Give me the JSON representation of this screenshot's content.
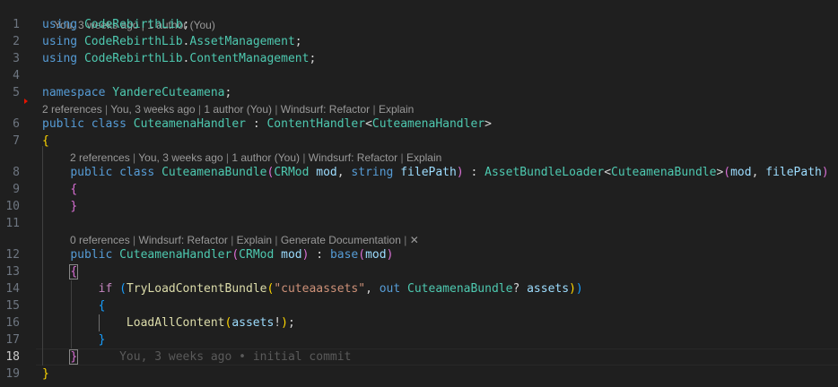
{
  "blame_header": "You, 3 weeks ago | 1 author (You)",
  "line_numbers": [
    "1",
    "2",
    "3",
    "4",
    "5",
    "6",
    "7",
    "8",
    "9",
    "10",
    "11",
    "12",
    "13",
    "14",
    "15",
    "16",
    "17",
    "18",
    "19"
  ],
  "code": {
    "using": "using",
    "ns1": "CodeRebirthLib",
    "ns2a": "CodeRebirthLib",
    "ns2b": "AssetManagement",
    "ns3a": "CodeRebirthLib",
    "ns3b": "ContentManagement",
    "namespace_kw": "namespace",
    "namespace_name": "YandereCuteamena",
    "public": "public",
    "class": "class",
    "string": "string",
    "out": "out",
    "base": "base",
    "if": "if",
    "handler_class": "CuteamenaHandler",
    "content_handler": "ContentHandler",
    "bundle_class": "CuteamenaBundle",
    "crmod": "CRMod",
    "mod": "mod",
    "filepath": "filePath",
    "asset_loader": "AssetBundleLoader",
    "try_load": "TryLoadContentBundle",
    "bundle_string": "\"cuteaassets\"",
    "assets": "assets",
    "load_all": "LoadAllContent"
  },
  "codelens": {
    "line6": {
      "references": "2 references",
      "blame": "You, 3 weeks ago",
      "authors": "1 author (You)",
      "windsurf": "Windsurf: Refactor",
      "explain": "Explain"
    },
    "line8": {
      "references": "2 references",
      "blame": "You, 3 weeks ago",
      "authors": "1 author (You)",
      "windsurf": "Windsurf: Refactor",
      "explain": "Explain"
    },
    "line12": {
      "references": "0 references",
      "windsurf": "Windsurf: Refactor",
      "explain": "Explain",
      "generate_docs": "Generate Documentation",
      "close": "✕"
    }
  },
  "inline_blame": "You, 3 weeks ago • initial commit",
  "active_line": "18",
  "colors": {
    "background": "#1f1f1f",
    "keyword": "#569cd6",
    "type": "#4ec9b0",
    "function": "#dcdcaa",
    "variable": "#9cdcfe",
    "string": "#ce9178",
    "control": "#c586c0",
    "bracket_level1": "#ffd700",
    "bracket_level2": "#da70d6",
    "bracket_level3": "#179fff"
  }
}
